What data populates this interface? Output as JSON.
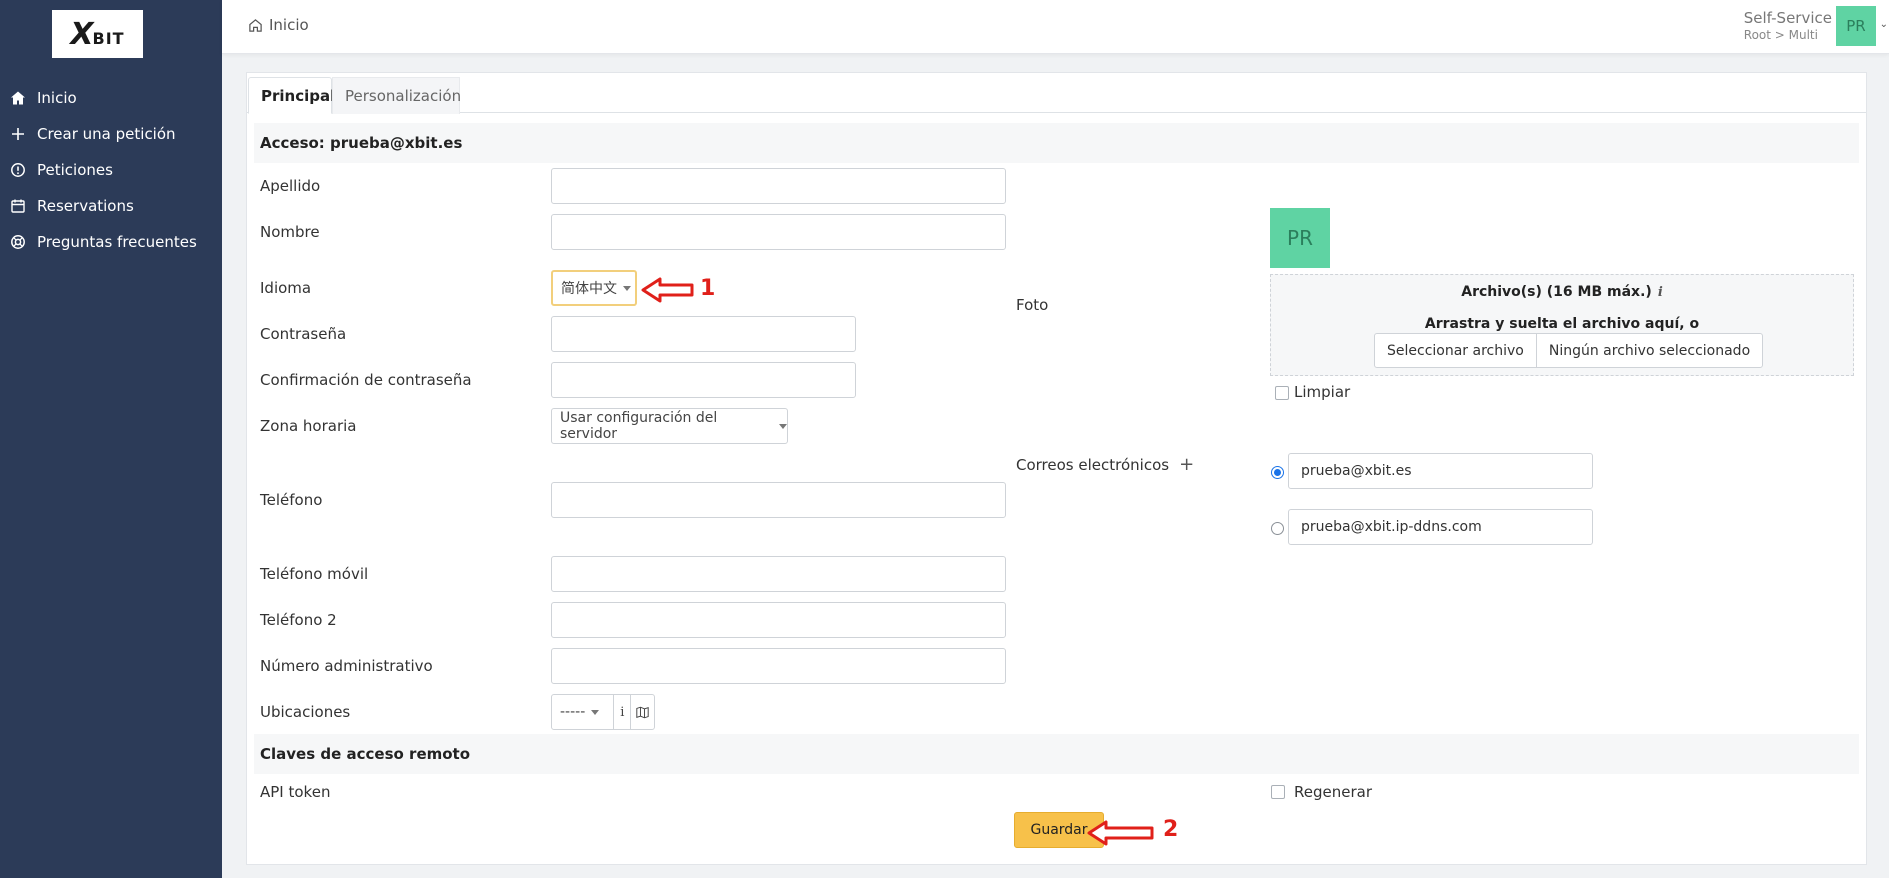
{
  "sidebar": {
    "logo": "XBIT",
    "items": [
      {
        "label": "Inicio",
        "icon": "home-icon"
      },
      {
        "label": "Crear una petición",
        "icon": "plus-icon"
      },
      {
        "label": "Peticiones",
        "icon": "alert-circle-icon"
      },
      {
        "label": "Reservations",
        "icon": "calendar-icon"
      },
      {
        "label": "Preguntas frecuentes",
        "icon": "lifebuoy-icon"
      }
    ]
  },
  "topbar": {
    "breadcrumb": "Inicio",
    "profile_title": "Self-Service",
    "profile_sub": "Root > Multi",
    "avatar_initials": "PR"
  },
  "tabs": [
    {
      "label": "Principal",
      "active": true
    },
    {
      "label": "Personalización",
      "active": false
    }
  ],
  "form": {
    "access_title": "Acceso: prueba@xbit.es",
    "labels": {
      "apellido": "Apellido",
      "nombre": "Nombre",
      "idioma": "Idioma",
      "contrasena": "Contraseña",
      "confirmacion": "Confirmación de contraseña",
      "zona": "Zona horaria",
      "telefono": "Teléfono",
      "movil": "Teléfono móvil",
      "telefono2": "Teléfono 2",
      "numero_admin": "Número administrativo",
      "ubicaciones": "Ubicaciones",
      "foto": "Foto",
      "correos": "Correos electrónicos"
    },
    "values": {
      "apellido": "",
      "nombre": "",
      "contrasena": "",
      "confirmacion": "",
      "telefono": "",
      "movil": "",
      "telefono2": "",
      "numero_admin": ""
    },
    "idioma_selected": "简体中文",
    "zona_selected": "Usar configuración del servidor",
    "ubicaciones_selected": "-----",
    "ubicaciones_info": "i",
    "photo": {
      "initials": "PR",
      "dropzone_title": "Archivo(s) (16 MB máx.)",
      "dropzone_info": "i",
      "dropzone_drag": "Arrastra y suelta el archivo aquí, o",
      "select_button": "Seleccionar archivo",
      "no_file": "Ningún archivo seleccionado",
      "clear_label": "Limpiar"
    },
    "emails": [
      {
        "value": "prueba@xbit.es",
        "default": true
      },
      {
        "value": "prueba@xbit.ip-ddns.com",
        "default": false
      }
    ],
    "add_email_symbol": "+",
    "remote_title": "Claves de acceso remoto",
    "api_token_label": "API token",
    "regenerate_label": "Regenerar",
    "save_label": "Guardar"
  },
  "annotations": [
    {
      "number": "1",
      "target": "idioma"
    },
    {
      "number": "2",
      "target": "guardar"
    }
  ],
  "colors": {
    "sidebar_bg": "#2c3b58",
    "accent_green": "#5fd3a3",
    "save_button": "#f7c14a",
    "annotation_red": "#e0201a"
  }
}
